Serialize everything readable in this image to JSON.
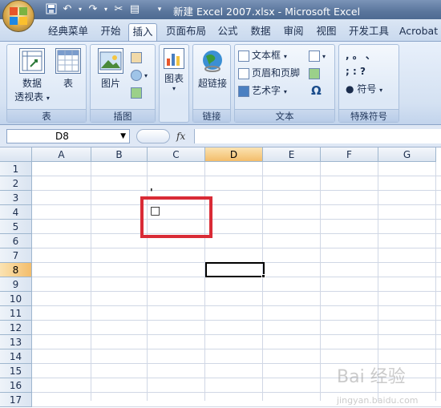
{
  "window": {
    "title": "新建 Excel 2007.xlsx - Microsoft Excel"
  },
  "quick_access": [
    "save-icon",
    "undo-icon",
    "redo-icon",
    "format-painter-icon",
    "paste-icon",
    "customize-dropdown-icon"
  ],
  "tabs": [
    {
      "label": "经典菜单",
      "active": false
    },
    {
      "label": "开始",
      "active": false
    },
    {
      "label": "插入",
      "active": true
    },
    {
      "label": "页面布局",
      "active": false
    },
    {
      "label": "公式",
      "active": false
    },
    {
      "label": "数据",
      "active": false
    },
    {
      "label": "审阅",
      "active": false
    },
    {
      "label": "视图",
      "active": false
    },
    {
      "label": "开发工具",
      "active": false
    },
    {
      "label": "Acrobat",
      "active": false
    }
  ],
  "ribbon": {
    "groups": {
      "table": {
        "label": "表",
        "pivot_label_1": "数据",
        "pivot_label_2": "透视表",
        "table_label": "表"
      },
      "illustrations": {
        "label": "插图",
        "picture_label": "图片"
      },
      "charts": {
        "chart_label": "图表"
      },
      "links": {
        "label": "链接",
        "hyperlink_label": "超链接"
      },
      "text": {
        "label": "文本",
        "textbox_label": "文本框",
        "header_footer_label": "页眉和页脚",
        "wordart_label": "艺术字",
        "omega": "Ω"
      },
      "special": {
        "label": "特殊符号",
        "row1": ",    。    、",
        "row2": ";    :    ?",
        "symbol_label": "符号"
      }
    }
  },
  "formula_bar": {
    "name_box": "D8",
    "fx": "fx"
  },
  "grid": {
    "columns": [
      "A",
      "B",
      "C",
      "D",
      "E",
      "F",
      "G"
    ],
    "selected_column": "D",
    "rows": [
      "1",
      "2",
      "3",
      "4",
      "5",
      "6",
      "7",
      "8",
      "9",
      "10",
      "11",
      "12",
      "13",
      "14",
      "15",
      "16",
      "17"
    ],
    "selected_row": "8",
    "cell_c3_mark": "'",
    "cell_c4_symbol": "□"
  },
  "watermark": {
    "text": "Bai 经验",
    "sub": "jingyan.baidu.com"
  },
  "colors": {
    "highlight_box": "#d92b36",
    "selected_header": "#f3bd6b"
  }
}
